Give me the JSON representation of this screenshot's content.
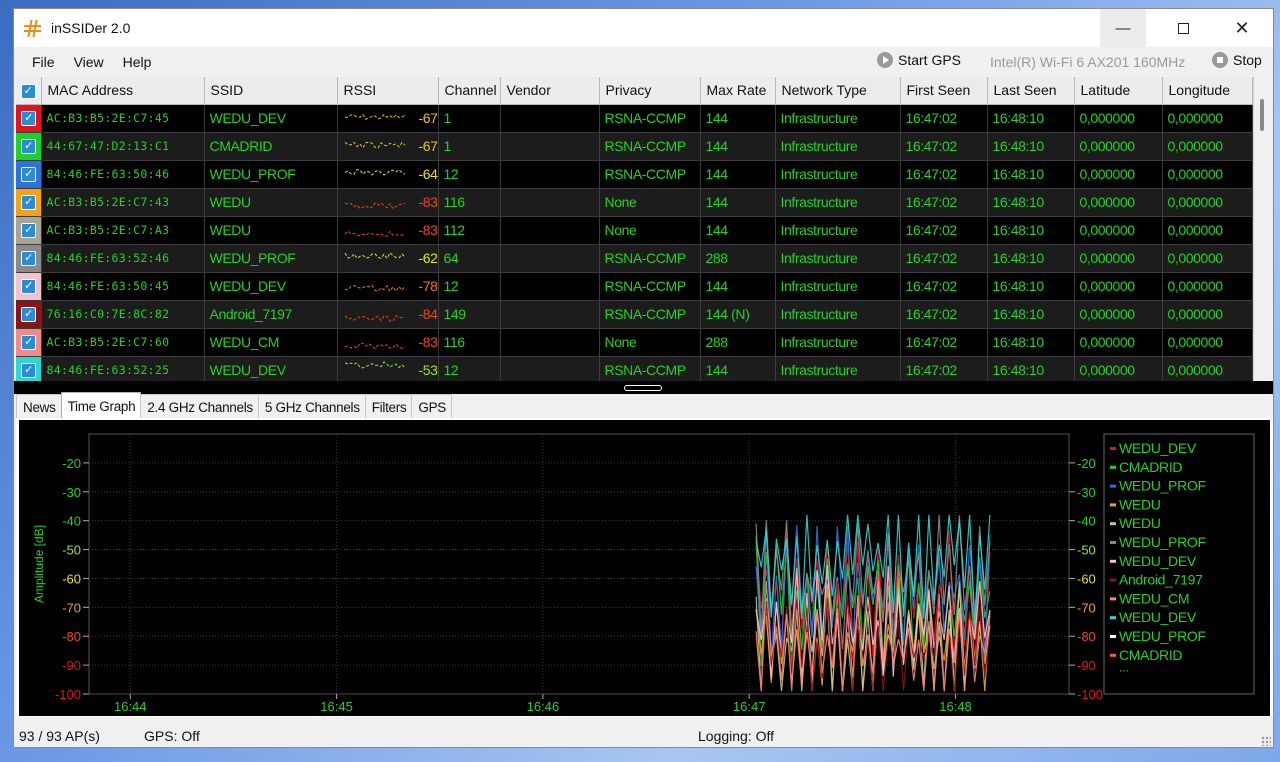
{
  "window": {
    "title": "inSSIDer 2.0"
  },
  "menu": {
    "items": [
      "File",
      "View",
      "Help"
    ]
  },
  "toolbar": {
    "start_gps": "Start GPS",
    "adapter": "Intel(R) Wi-Fi 6 AX201 160MHz",
    "stop": "Stop"
  },
  "table": {
    "columns": [
      "MAC Address",
      "SSID",
      "RSSI",
      "Channel",
      "Vendor",
      "Privacy",
      "Max Rate",
      "Network Type",
      "First Seen",
      "Last Seen",
      "Latitude",
      "Longitude"
    ],
    "rows": [
      {
        "color": "#e0151b",
        "mac": "AC:B3:B5:2E:C7:45",
        "ssid": "WEDU_DEV",
        "rssi": "-67",
        "rssi_color": "#e8c51a",
        "channel": "1",
        "vendor": "",
        "privacy": "RSNA-CCMP",
        "max_rate": "144",
        "type": "Infrastructure",
        "first": "16:47:02",
        "last": "16:48:10",
        "lat": "0,000000",
        "lon": "0,000000"
      },
      {
        "color": "#1fcf2a",
        "mac": "44:67:47:D2:13:C1",
        "ssid": "CMADRID",
        "rssi": "-67",
        "rssi_color": "#e8c51a",
        "channel": "1",
        "vendor": "",
        "privacy": "RSNA-CCMP",
        "max_rate": "144",
        "type": "Infrastructure",
        "first": "16:47:02",
        "last": "16:48:10",
        "lat": "0,000000",
        "lon": "0,000000"
      },
      {
        "color": "#2f72d8",
        "mac": "84:46:FE:63:50:46",
        "ssid": "WEDU_PROF",
        "rssi": "-64",
        "rssi_color": "#e8e21a",
        "channel": "12",
        "vendor": "",
        "privacy": "RSNA-CCMP",
        "max_rate": "144",
        "type": "Infrastructure",
        "first": "16:47:02",
        "last": "16:48:10",
        "lat": "0,000000",
        "lon": "0,000000"
      },
      {
        "color": "#f5a11a",
        "mac": "AC:B3:B5:2E:C7:43",
        "ssid": "WEDU",
        "rssi": "-83",
        "rssi_color": "#f0461a",
        "channel": "116",
        "vendor": "",
        "privacy": "None",
        "max_rate": "144",
        "type": "Infrastructure",
        "first": "16:47:02",
        "last": "16:48:10",
        "lat": "0,000000",
        "lon": "0,000000"
      },
      {
        "color": "#a9a592",
        "mac": "AC:B3:B5:2E:C7:A3",
        "ssid": "WEDU",
        "rssi": "-83",
        "rssi_color": "#f0461a",
        "channel": "112",
        "vendor": "",
        "privacy": "None",
        "max_rate": "144",
        "type": "Infrastructure",
        "first": "16:47:02",
        "last": "16:48:10",
        "lat": "0,000000",
        "lon": "0,000000"
      },
      {
        "color": "#8a8a8a",
        "mac": "84:46:FE:63:52:46",
        "ssid": "WEDU_PROF",
        "rssi": "-62",
        "rssi_color": "#d9ea1a",
        "channel": "64",
        "vendor": "",
        "privacy": "RSNA-CCMP",
        "max_rate": "288",
        "type": "Infrastructure",
        "first": "16:47:02",
        "last": "16:48:10",
        "lat": "0,000000",
        "lon": "0,000000"
      },
      {
        "color": "#f3c1cf",
        "mac": "84:46:FE:63:50:45",
        "ssid": "WEDU_DEV",
        "rssi": "-78",
        "rssi_color": "#f0781a",
        "channel": "12",
        "vendor": "",
        "privacy": "RSNA-CCMP",
        "max_rate": "144",
        "type": "Infrastructure",
        "first": "16:47:02",
        "last": "16:48:10",
        "lat": "0,000000",
        "lon": "0,000000"
      },
      {
        "color": "#8b1515",
        "mac": "76:16:C0:7E:8C:82",
        "ssid": "Android_7197",
        "rssi": "-84",
        "rssi_color": "#f0461a",
        "channel": "149",
        "vendor": "",
        "privacy": "RSNA-CCMP",
        "max_rate": "144 (N)",
        "type": "Infrastructure",
        "first": "16:47:02",
        "last": "16:48:10",
        "lat": "0,000000",
        "lon": "0,000000"
      },
      {
        "color": "#f08a84",
        "mac": "AC:B3:B5:2E:C7:60",
        "ssid": "WEDU_CM",
        "rssi": "-83",
        "rssi_color": "#f0461a",
        "channel": "116",
        "vendor": "",
        "privacy": "None",
        "max_rate": "288",
        "type": "Infrastructure",
        "first": "16:47:02",
        "last": "16:48:10",
        "lat": "0,000000",
        "lon": "0,000000"
      },
      {
        "color": "#2fd7d2",
        "mac": "84:46:FE:63:52:25",
        "ssid": "WEDU_DEV",
        "rssi": "-53",
        "rssi_color": "#9be81a",
        "channel": "12",
        "vendor": "",
        "privacy": "RSNA-CCMP",
        "max_rate": "144",
        "type": "Infrastructure",
        "first": "16:47:02",
        "last": "16:48:10",
        "lat": "0,000000",
        "lon": "0,000000"
      }
    ]
  },
  "tabs": [
    "News",
    "Time Graph",
    "2.4 GHz Channels",
    "5 GHz Channels",
    "Filters",
    "GPS"
  ],
  "active_tab": "Time Graph",
  "chart_data": {
    "type": "line",
    "ylabel": "Amplitude [dB]",
    "ylim": [
      -100,
      -10
    ],
    "yticks": [
      -20,
      -30,
      -40,
      -50,
      -60,
      -70,
      -80,
      -90,
      -100
    ],
    "xticks": [
      "16:44",
      "16:45",
      "16:46",
      "16:47",
      "16:48"
    ],
    "grid": true,
    "legend_position": "right",
    "legend": [
      {
        "name": "WEDU_DEV",
        "color": "#e0151b"
      },
      {
        "name": "CMADRID",
        "color": "#1fcf2a"
      },
      {
        "name": "WEDU_PROF",
        "color": "#2f72d8"
      },
      {
        "name": "WEDU",
        "color": "#f5a11a"
      },
      {
        "name": "WEDU",
        "color": "#c8c48f"
      },
      {
        "name": "WEDU_PROF",
        "color": "#8a8a8a"
      },
      {
        "name": "WEDU_DEV",
        "color": "#f3c1cf"
      },
      {
        "name": "Android_7197",
        "color": "#8b1515"
      },
      {
        "name": "WEDU_CM",
        "color": "#f08a84"
      },
      {
        "name": "WEDU_DEV",
        "color": "#2fd7d2"
      },
      {
        "name": "WEDU_PROF",
        "color": "#ffffff"
      },
      {
        "name": "CMADRID",
        "color": "#f0641a"
      }
    ],
    "legend_more": "...",
    "series": [
      {
        "color": "#e0151b",
        "x": [
          "16:47:02",
          "16:48:10"
        ],
        "y": [
          -67,
          -67
        ]
      },
      {
        "color": "#1fcf2a",
        "x": [
          "16:47:02",
          "16:48:10"
        ],
        "y": [
          -67,
          -67
        ]
      },
      {
        "color": "#2f72d8",
        "x": [
          "16:47:02",
          "16:48:10"
        ],
        "y": [
          -64,
          -64
        ]
      },
      {
        "color": "#f5a11a",
        "x": [
          "16:47:02",
          "16:48:10"
        ],
        "y": [
          -83,
          -83
        ]
      },
      {
        "color": "#c8c48f",
        "x": [
          "16:47:02",
          "16:48:10"
        ],
        "y": [
          -83,
          -83
        ]
      },
      {
        "color": "#8a8a8a",
        "x": [
          "16:47:02",
          "16:48:10"
        ],
        "y": [
          -62,
          -62
        ]
      },
      {
        "color": "#f3c1cf",
        "x": [
          "16:47:02",
          "16:48:10"
        ],
        "y": [
          -78,
          -78
        ]
      },
      {
        "color": "#8b1515",
        "x": [
          "16:47:02",
          "16:48:10"
        ],
        "y": [
          -84,
          -84
        ]
      },
      {
        "color": "#f08a84",
        "x": [
          "16:47:02",
          "16:48:10"
        ],
        "y": [
          -83,
          -83
        ]
      },
      {
        "color": "#2fd7d2",
        "x": [
          "16:47:02",
          "16:48:10"
        ],
        "y": [
          -53,
          -53
        ]
      }
    ]
  },
  "status": {
    "ap_count": "93 / 93 AP(s)",
    "gps": "GPS: Off",
    "logging": "Logging: Off"
  }
}
